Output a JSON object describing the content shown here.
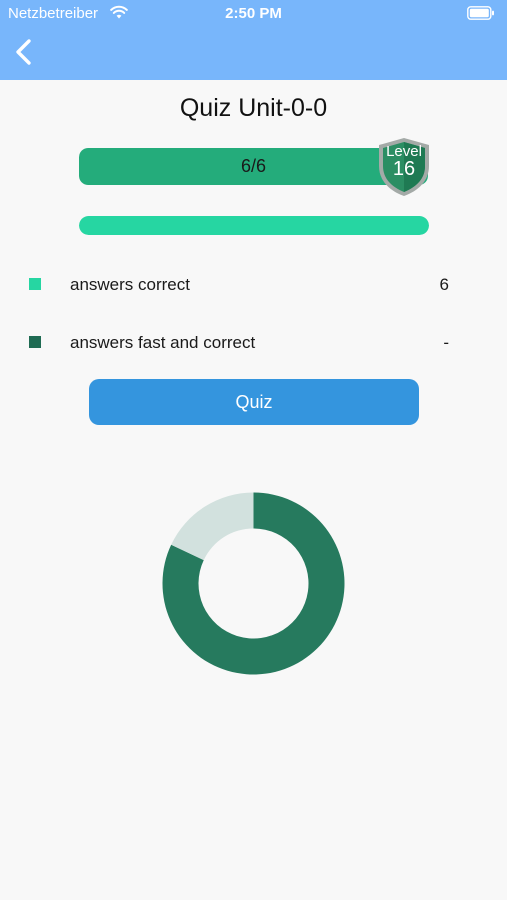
{
  "status_bar": {
    "carrier": "Netzbetreiber",
    "time": "2:50 PM"
  },
  "header": {
    "back_icon": "chevron-left-icon"
  },
  "page": {
    "title": "Quiz Unit-0-0"
  },
  "progress": {
    "label": "6/6",
    "fraction": 1.0
  },
  "level": {
    "label": "Level",
    "number": "16"
  },
  "secondary_progress": {
    "fraction": 1.0
  },
  "stats": [
    {
      "label": "answers correct",
      "value": "6",
      "color": "#26d6a2"
    },
    {
      "label": "answers fast and correct",
      "value": "-",
      "color": "#1f6b53"
    }
  ],
  "quiz_button": {
    "label": "Quiz"
  },
  "colors": {
    "header_bg": "#78b6fb",
    "accent": "#24ac7b",
    "button": "#3495de",
    "donut_main": "#267a5e",
    "donut_rest": "#d2e1de"
  },
  "chart_data": {
    "type": "pie",
    "categories": [
      "",
      ""
    ],
    "values": [
      82,
      18
    ],
    "title": "",
    "xlabel": "",
    "ylabel": ""
  }
}
